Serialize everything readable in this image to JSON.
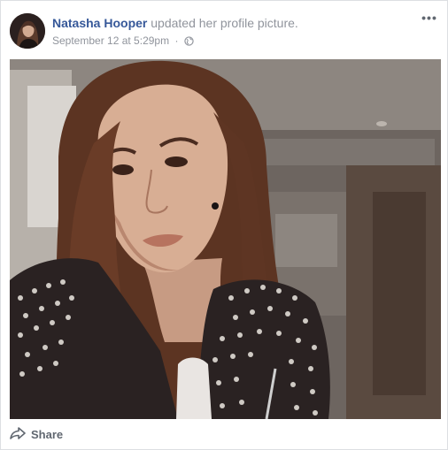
{
  "post": {
    "author": "Natasha Hooper",
    "action": "updated her profile picture.",
    "timestamp": "September 12 at 5:29pm",
    "separator": "·",
    "privacy_icon": "globe-icon",
    "more_icon": "more-options-icon",
    "more_label": "•••"
  },
  "photo": {
    "subject": "profile-photo"
  },
  "footer": {
    "share_label": "Share",
    "share_icon": "share-arrow-icon"
  },
  "colors": {
    "author_link": "#365899",
    "secondary_text": "#90949c",
    "action_text": "#606770",
    "border": "#dddfe2"
  }
}
